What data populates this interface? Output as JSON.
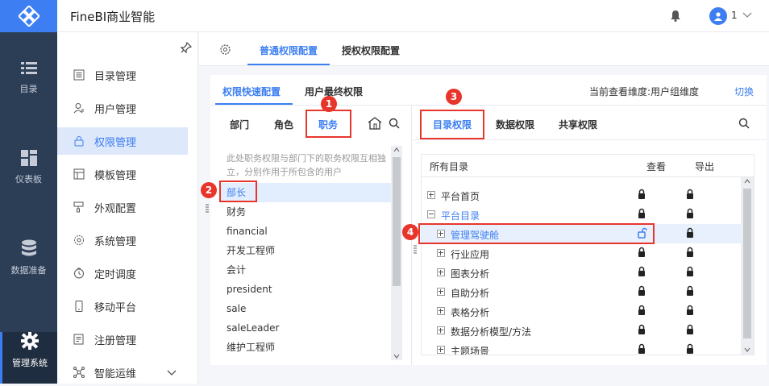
{
  "rail": {
    "items": [
      {
        "label": "目录",
        "icon": "list-icon"
      },
      {
        "label": "仪表板",
        "icon": "dashboard-icon"
      },
      {
        "label": "数据准备",
        "icon": "database-icon"
      },
      {
        "label": "管理系统",
        "icon": "gear-icon"
      }
    ]
  },
  "header": {
    "title": "FineBI商业智能",
    "user": "1"
  },
  "menu": {
    "items": [
      {
        "label": "目录管理"
      },
      {
        "label": "用户管理"
      },
      {
        "label": "权限管理"
      },
      {
        "label": "模板管理"
      },
      {
        "label": "外观配置"
      },
      {
        "label": "系统管理"
      },
      {
        "label": "定时调度"
      },
      {
        "label": "移动平台"
      },
      {
        "label": "注册管理"
      },
      {
        "label": "智能运维"
      }
    ]
  },
  "content_tabs": {
    "general": "普通权限配置",
    "grant": "授权权限配置"
  },
  "sub_tabs": {
    "quick": "权限快速配置",
    "final": "用户最终权限"
  },
  "dimension": {
    "label": "当前查看维度:用户组维度",
    "switch": "切换"
  },
  "role_tabs": {
    "dept": "部门",
    "role": "角色",
    "post": "职务"
  },
  "hint": "此处职务权限与部门下的职务权限互相独立，分别作用于所包含的用户",
  "roles": [
    "部长",
    "财务",
    "financial",
    "开发工程师",
    "会计",
    "president",
    "sale",
    "saleLeader",
    "维护工程师"
  ],
  "perm_tabs": {
    "catalog": "目录权限",
    "data": "数据权限",
    "share": "共享权限"
  },
  "table": {
    "col_all": "所有目录",
    "col_view": "查看",
    "col_export": "导出",
    "rows": [
      {
        "label": "平台首页"
      },
      {
        "label": "平台目录"
      },
      {
        "label": "管理驾驶舱"
      },
      {
        "label": "行业应用"
      },
      {
        "label": "图表分析"
      },
      {
        "label": "自助分析"
      },
      {
        "label": "表格分析"
      },
      {
        "label": "数据分析模型/方法"
      },
      {
        "label": "主题场景"
      }
    ]
  },
  "badges": [
    "1",
    "2",
    "3",
    "4"
  ],
  "colors": {
    "accent": "#3d7ff2",
    "annotation": "#e8352c",
    "rail": "#2c3e56"
  }
}
